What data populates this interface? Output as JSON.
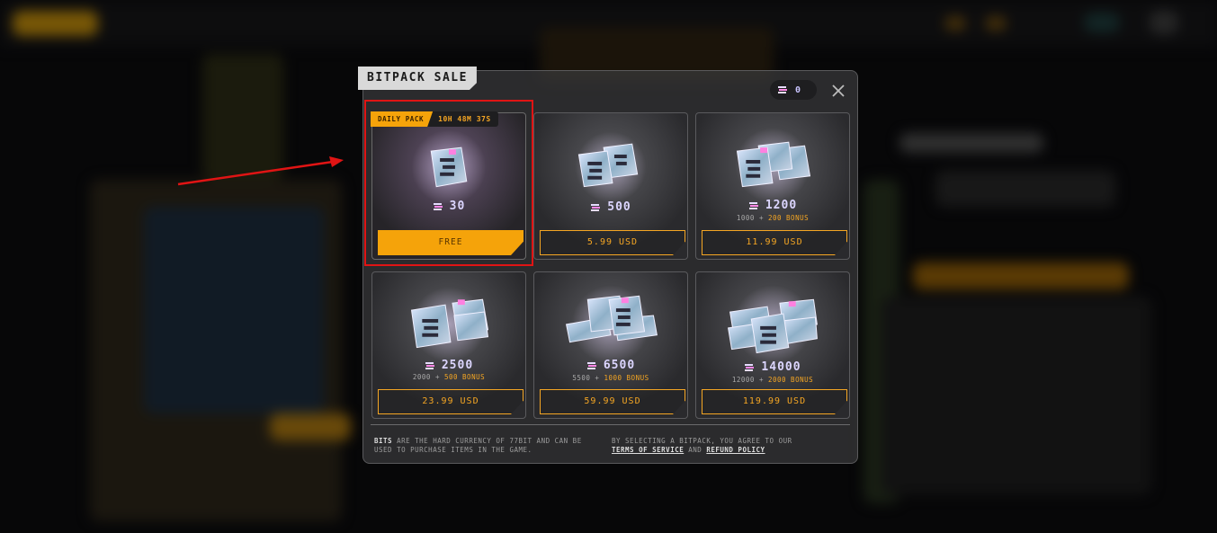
{
  "modal": {
    "title": "BITPACK SALE",
    "balance": "0",
    "close_icon": "close-icon"
  },
  "daily": {
    "tag": "DAILY PACK",
    "timer": "10H 48M 37S",
    "amount": "30",
    "button": "FREE"
  },
  "packs": [
    {
      "amount": "500",
      "base": "",
      "bonus": "",
      "price": "5.99 USD"
    },
    {
      "amount": "1200",
      "base": "1000 +",
      "bonus": "200 BONUS",
      "price": "11.99 USD"
    },
    {
      "amount": "2500",
      "base": "2000 +",
      "bonus": "500 BONUS",
      "price": "23.99 USD"
    },
    {
      "amount": "6500",
      "base": "5500 +",
      "bonus": "1000 BONUS",
      "price": "59.99 USD"
    },
    {
      "amount": "14000",
      "base": "12000 +",
      "bonus": "2000 BONUS",
      "price": "119.99 USD"
    }
  ],
  "footer": {
    "left_bold": "BITS",
    "left_rest": " ARE THE HARD CURRENCY OF 77BIT AND CAN BE USED TO PURCHASE ITEMS IN THE GAME.",
    "right_text": "BY SELECTING A BITPACK, YOU AGREE TO OUR",
    "terms": "TERMS OF SERVICE",
    "and": "AND",
    "refund": "REFUND POLICY"
  },
  "colors": {
    "accent": "#f5a623",
    "highlight": "#e01414"
  }
}
